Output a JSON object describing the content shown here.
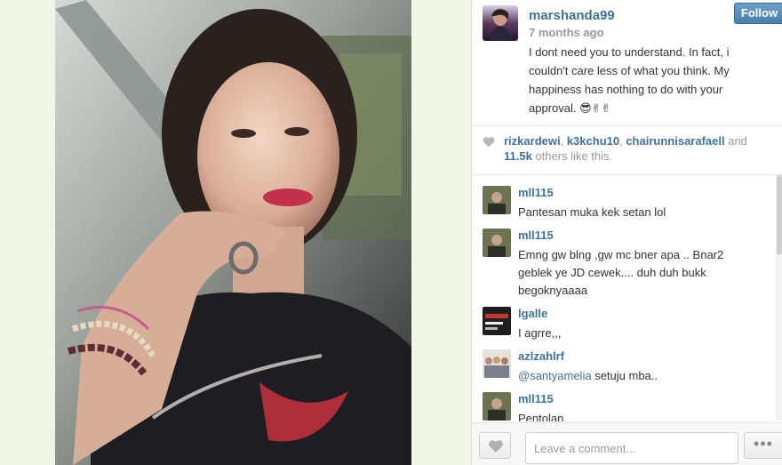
{
  "post": {
    "username": "marshanda99",
    "time_ago": "7 months ago",
    "follow_label": "Follow",
    "caption": "I dont need you to understand. In fact, i couldn't care less of what you think. My happiness has nothing to do with your approval. 😎✌✌"
  },
  "likes": {
    "names": [
      "rizkardewi",
      "k3kchu10",
      "chairunnisarafaell"
    ],
    "sep1": ", ",
    "sep2": ", ",
    "and": " and",
    "count": "11.5k",
    "suffix": " others like this."
  },
  "comments": [
    {
      "user": "mll115",
      "text": "Pantesan muka kek setan lol"
    },
    {
      "user": "mll115",
      "text": "Emng gw blng ,gw mc bner apa .. Bnar2 geblek ye JD cewek.... duh duh bukk begoknyaaaa"
    },
    {
      "user": "lgalle",
      "text": "I agrre,,,"
    },
    {
      "user": "azlzahlrf",
      "mention": "@santyamelia",
      "text": " setuju mba.."
    },
    {
      "user": "mll115",
      "text": "Pentolan"
    }
  ],
  "footer": {
    "comment_placeholder": "Leave a comment...",
    "more_label": "•••"
  },
  "colors": {
    "link": "#3f729b",
    "follow_button": "#4a7fae",
    "muted": "#999999"
  },
  "icons": {
    "like_heart": "heart-icon",
    "likes_heart": "heart-icon",
    "more": "ellipsis-icon"
  }
}
